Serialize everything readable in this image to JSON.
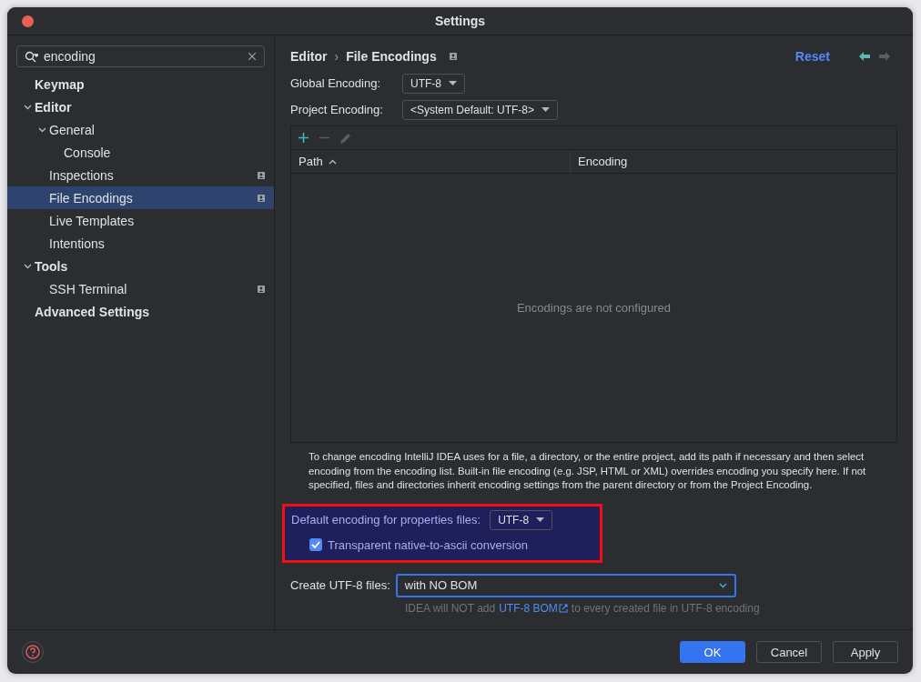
{
  "window": {
    "title": "Settings"
  },
  "search": {
    "value": "encoding"
  },
  "tree": [
    {
      "label": "Keymap",
      "selected": false,
      "project_level": false
    },
    {
      "label": "Editor",
      "expanded": true,
      "selected": false,
      "project_level": false,
      "children": [
        {
          "label": "General",
          "expanded": true,
          "selected": false,
          "project_level": false,
          "children": [
            {
              "label": "Console",
              "selected": false,
              "project_level": false
            }
          ]
        },
        {
          "label": "Inspections",
          "selected": false,
          "project_level": true
        },
        {
          "label": "File Encodings",
          "selected": true,
          "project_level": true
        },
        {
          "label": "Live Templates",
          "selected": false,
          "project_level": false
        },
        {
          "label": "Intentions",
          "selected": false,
          "project_level": false
        }
      ]
    },
    {
      "label": "Tools",
      "expanded": true,
      "selected": false,
      "project_level": false,
      "children": [
        {
          "label": "SSH Terminal",
          "selected": false,
          "project_level": true
        }
      ]
    },
    {
      "label": "Advanced Settings",
      "selected": false,
      "project_level": false
    }
  ],
  "breadcrumb": [
    "Editor",
    "File Encodings"
  ],
  "breadcrumb_separator": "›",
  "reset": "Reset",
  "nav": {
    "back_enabled": true,
    "forward_enabled": false
  },
  "global_encoding": {
    "label": "Global Encoding:",
    "value": "UTF-8"
  },
  "project_encoding": {
    "label": "Project Encoding:",
    "value": "<System Default: UTF-8>"
  },
  "table": {
    "toolbar": {
      "add_enabled": true,
      "remove_enabled": false,
      "edit_enabled": false
    },
    "columns": [
      {
        "label": "Path",
        "sorted": true
      },
      {
        "label": "Encoding",
        "sorted": false
      }
    ],
    "empty_text": "Encodings are not configured"
  },
  "description": "To change encoding IntelliJ IDEA uses for a file, a directory, or the entire project, add its path if necessary and then select encoding from the encoding list. Built-in file encoding (e.g. JSP, HTML or XML) overrides encoding you specify here. If not specified, files and directories inherit encoding settings from the parent directory or from the Project Encoding.",
  "properties": {
    "highlighted": true,
    "label": "Default encoding for properties files:",
    "value": "UTF-8",
    "checkbox": {
      "label": "Transparent native-to-ascii conversion",
      "checked": true
    }
  },
  "create_utf8": {
    "label": "Create UTF-8 files:",
    "value": "with NO BOM",
    "focused": true
  },
  "hint": {
    "before": "IDEA will NOT add",
    "link": "UTF-8 BOM",
    "after": "to every created file in UTF-8 encoding"
  },
  "buttons": [
    {
      "label": "OK",
      "kind": "primary"
    },
    {
      "label": "Cancel",
      "kind": "secondary"
    },
    {
      "label": "Apply",
      "kind": "secondary"
    }
  ]
}
